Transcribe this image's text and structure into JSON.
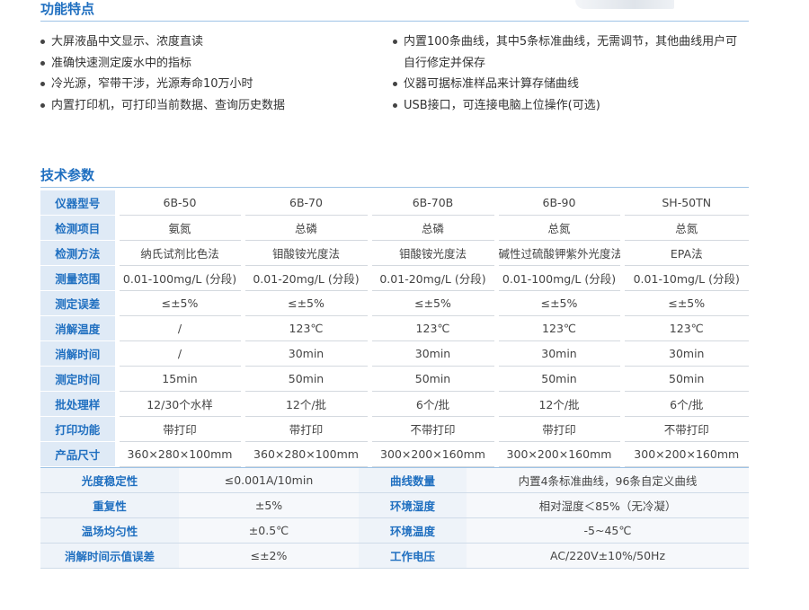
{
  "features_section": {
    "title": "功能特点",
    "left": [
      "大屏液晶中文显示、浓度直读",
      "准确快速测定废水中的指标",
      "冷光源，窄带干涉，光源寿命10万小时",
      "内置打印机，可打印当前数据、查询历史数据"
    ],
    "right": [
      "内置100条曲线，其中5条标准曲线，无需调节，其他曲线用户可",
      "自行修定并保存",
      "仪器可据标准样品来计算存储曲线",
      "USB接口，可连接电脑上位操作(可选)"
    ]
  },
  "tech_section": {
    "title": "技术参数",
    "rows": [
      {
        "label": "仪器型号",
        "values": [
          "6B-50",
          "6B-70",
          "6B-70B",
          "6B-90",
          "SH-50TN"
        ]
      },
      {
        "label": "检测项目",
        "values": [
          "氨氮",
          "总磷",
          "总磷",
          "总氮",
          "总氮"
        ]
      },
      {
        "label": "检测方法",
        "values": [
          "纳氏试剂比色法",
          "钼酸铵光度法",
          "钼酸铵光度法",
          "碱性过硫酸钾紫外光度法",
          "EPA法"
        ]
      },
      {
        "label": "测量范围",
        "values": [
          "0.01-100mg/L (分段)",
          "0.01-20mg/L (分段)",
          "0.01-20mg/L (分段)",
          "0.01-100mg/L (分段)",
          "0.01-10mg/L (分段)"
        ]
      },
      {
        "label": "测定误差",
        "values": [
          "≤±5%",
          "≤±5%",
          "≤±5%",
          "≤±5%",
          "≤±5%"
        ]
      },
      {
        "label": "消解温度",
        "values": [
          "/",
          "123℃",
          "123℃",
          "123℃",
          "123℃"
        ]
      },
      {
        "label": "消解时间",
        "values": [
          "/",
          "30min",
          "30min",
          "30min",
          "30min"
        ]
      },
      {
        "label": "测定时间",
        "values": [
          "15min",
          "50min",
          "50min",
          "50min",
          "50min"
        ]
      },
      {
        "label": "批处理样",
        "values": [
          "12/30个水样",
          "12个/批",
          "6个/批",
          "12个/批",
          "6个/批"
        ]
      },
      {
        "label": "打印功能",
        "values": [
          "带打印",
          "带打印",
          "不带打印",
          "带打印",
          "不带打印"
        ]
      },
      {
        "label": "产品尺寸",
        "values": [
          "360×280×100mm",
          "360×280×100mm",
          "300×200×160mm",
          "300×200×160mm",
          "300×200×160mm"
        ]
      }
    ],
    "specs": [
      {
        "l1": "光度稳定性",
        "v1": "≤0.001A/10min",
        "l2": "曲线数量",
        "v2": "内置4条标准曲线，96条自定义曲线"
      },
      {
        "l1": "重复性",
        "v1": "±5%",
        "l2": "环境湿度",
        "v2": "相对湿度＜85%（无冷凝）"
      },
      {
        "l1": "温场均匀性",
        "v1": "±0.5℃",
        "l2": "环境温度",
        "v2": "-5~45℃"
      },
      {
        "l1": "消解时间示值误差",
        "v1": "≤±2%",
        "l2": "工作电压",
        "v2": "AC/220V±10%/50Hz"
      }
    ]
  }
}
